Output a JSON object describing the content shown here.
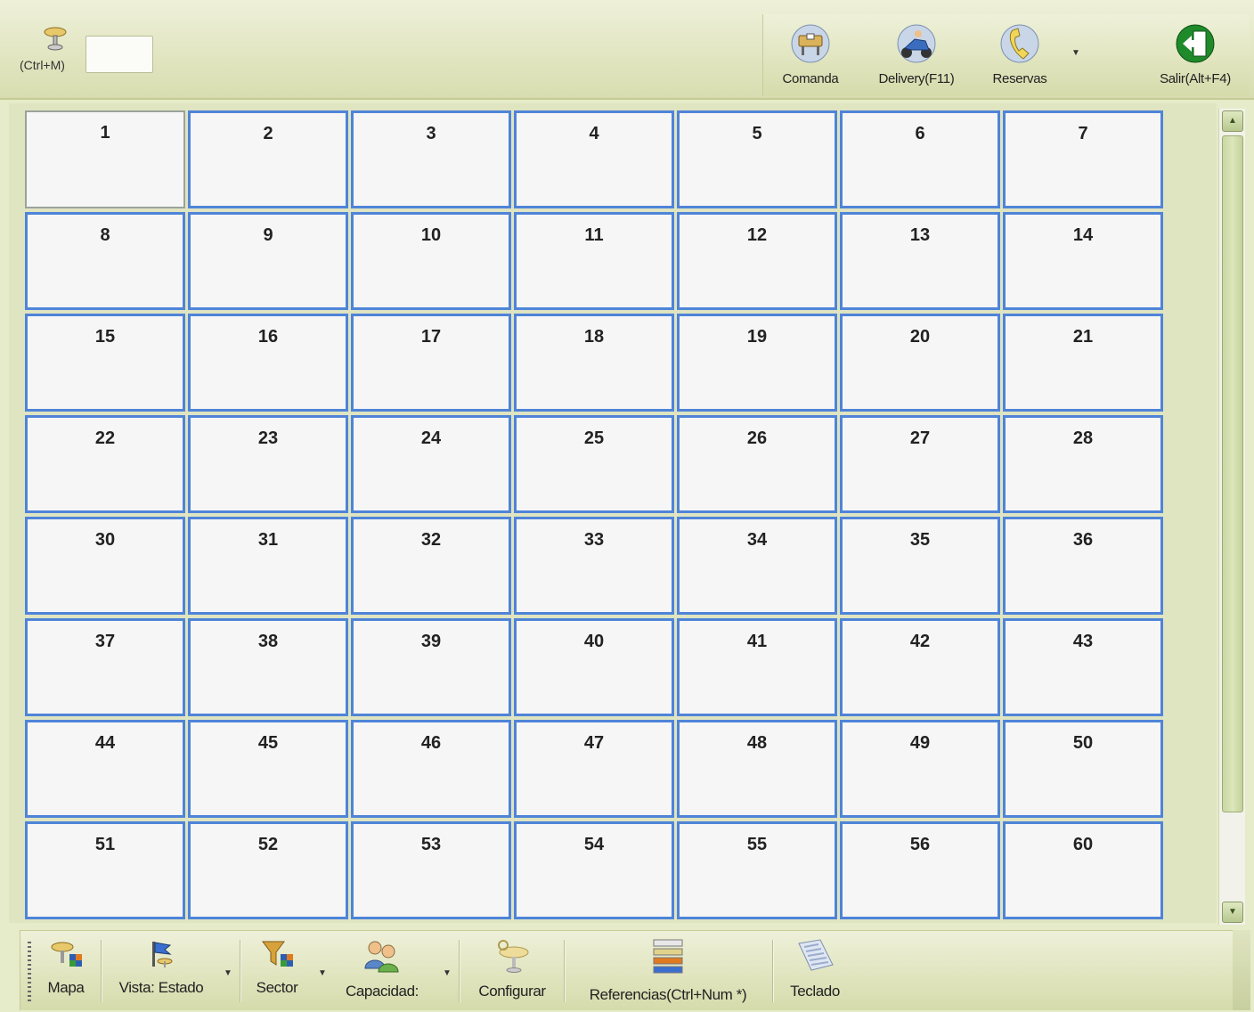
{
  "top_toolbar": {
    "shortcut_label": "(Ctrl+M)",
    "mesa_input_value": "",
    "buttons": [
      {
        "label": "Comanda",
        "icon": "table-order-icon"
      },
      {
        "label": "Delivery(F11)",
        "icon": "scooter-icon"
      },
      {
        "label": "Reservas",
        "icon": "phone-icon"
      },
      {
        "label": "Salir(Alt+F4)",
        "icon": "exit-door-icon"
      }
    ]
  },
  "tables": [
    "1",
    "2",
    "3",
    "4",
    "5",
    "6",
    "7",
    "8",
    "9",
    "10",
    "11",
    "12",
    "13",
    "14",
    "15",
    "16",
    "17",
    "18",
    "19",
    "20",
    "21",
    "22",
    "23",
    "24",
    "25",
    "26",
    "27",
    "28",
    "30",
    "31",
    "32",
    "33",
    "34",
    "35",
    "36",
    "37",
    "38",
    "39",
    "40",
    "41",
    "42",
    "43",
    "44",
    "45",
    "46",
    "47",
    "48",
    "49",
    "50",
    "51",
    "52",
    "53",
    "54",
    "55",
    "56",
    "60"
  ],
  "bottom_toolbar": {
    "buttons": [
      {
        "label": "Mapa",
        "icon": "map-tables-icon"
      },
      {
        "label": "Vista: Estado",
        "icon": "flag-icon"
      },
      {
        "label": "Sector",
        "icon": "filter-funnel-icon"
      },
      {
        "label": "Capacidad:",
        "icon": "people-icon"
      },
      {
        "label": "Configurar",
        "icon": "configure-table-icon"
      },
      {
        "label": "Referencias(Ctrl+Num *)",
        "icon": "color-bars-icon"
      },
      {
        "label": "Teclado",
        "icon": "keyboard-icon"
      }
    ]
  },
  "colors": {
    "table_border": "#4f84d8",
    "background": "#e6ebc9",
    "toolbar": "#d8ddb0"
  }
}
